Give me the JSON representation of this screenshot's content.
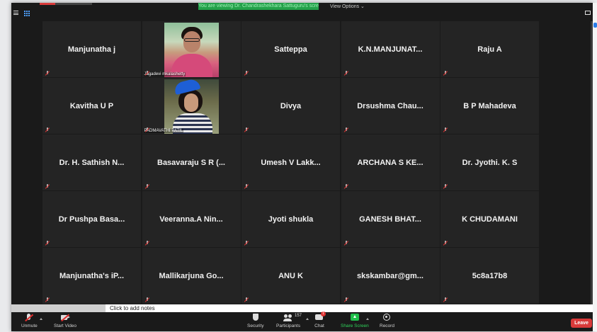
{
  "topbar": {
    "banner_text": "You are viewing Dr. Chandrashekhara Sattuguru's screen",
    "view_options_label": "View Options ⌄"
  },
  "participants": [
    {
      "name": "Manjunatha j",
      "video": false
    },
    {
      "name": "Jagadevi mkalashetty",
      "video": true
    },
    {
      "name": "Satteppa",
      "video": false
    },
    {
      "name": "K.N.MANJUNAT...",
      "video": false
    },
    {
      "name": "Raju A",
      "video": false
    },
    {
      "name": "Kavitha U P",
      "video": false
    },
    {
      "name": "PADMAVATHI PATIL",
      "video": true
    },
    {
      "name": "Divya",
      "video": false
    },
    {
      "name": "Drsushma  Chau...",
      "video": false
    },
    {
      "name": "B P Mahadeva",
      "video": false
    },
    {
      "name": "Dr. H. Sathish N...",
      "video": false
    },
    {
      "name": "Basavaraju S R (...",
      "video": false
    },
    {
      "name": "Umesh   V  Lakk...",
      "video": false
    },
    {
      "name": "ARCHANA  S KE...",
      "video": false
    },
    {
      "name": "Dr. Jyothi. K. S",
      "video": false
    },
    {
      "name": "Dr Pushpa  Basa...",
      "video": false
    },
    {
      "name": "Veeranna.A  Nin...",
      "video": false
    },
    {
      "name": "Jyoti shukla",
      "video": false
    },
    {
      "name": "GANESH  BHAT...",
      "video": false
    },
    {
      "name": "K CHUDAMANI",
      "video": false
    },
    {
      "name": "Manjunatha's  iP...",
      "video": false
    },
    {
      "name": "Mallikarjuna  Go...",
      "video": false
    },
    {
      "name": "ANU K",
      "video": false
    },
    {
      "name": "skskambar@gm...",
      "video": false
    },
    {
      "name": "5c8a17b8",
      "video": false
    }
  ],
  "notes": {
    "placeholder": "Click to add notes"
  },
  "toolbar": {
    "unmute_label": "Unmute",
    "start_video_label": "Start Video",
    "security_label": "Security",
    "participants_label": "Participants",
    "participants_count": "157",
    "chat_label": "Chat",
    "chat_badge": "1",
    "share_screen_label": "Share Screen",
    "record_label": "Record",
    "leave_label": "Leave"
  },
  "colors": {
    "banner": "#23a14a",
    "leave": "#d93a3a",
    "share": "#1fbf4a",
    "tile": "#242424"
  }
}
